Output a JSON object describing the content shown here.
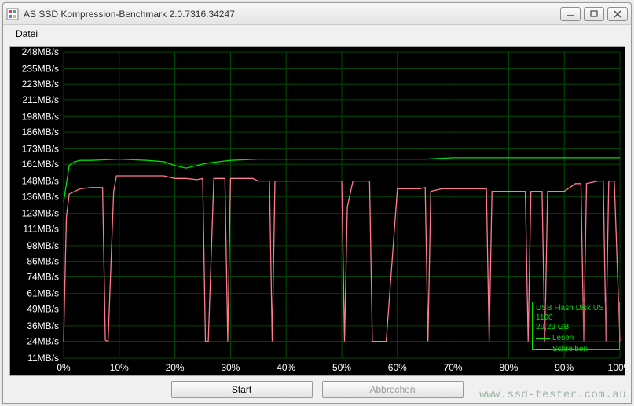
{
  "window": {
    "title": "AS SSD Kompression-Benchmark 2.0.7316.34247"
  },
  "menu": {
    "datei": "Datei"
  },
  "buttons": {
    "start": "Start",
    "abort": "Abbrechen"
  },
  "legend": {
    "device": "USB Flash Disk US",
    "device_line2": "1100",
    "size": "29,29 GB",
    "read": "Lesen",
    "write": "Schreiben",
    "read_color": "#00e000",
    "write_color": "#ff7a90"
  },
  "watermark": "www.ssd-tester.com.au",
  "chart_data": {
    "type": "line",
    "title": "",
    "xlabel": "",
    "ylabel": "",
    "y_ticks": [
      "248MB/s",
      "235MB/s",
      "223MB/s",
      "211MB/s",
      "198MB/s",
      "186MB/s",
      "173MB/s",
      "161MB/s",
      "148MB/s",
      "136MB/s",
      "123MB/s",
      "111MB/s",
      "98MB/s",
      "86MB/s",
      "74MB/s",
      "61MB/s",
      "49MB/s",
      "36MB/s",
      "24MB/s",
      "11MB/s"
    ],
    "y_range": [
      11,
      248
    ],
    "x_ticks": [
      "0%",
      "10%",
      "20%",
      "30%",
      "40%",
      "50%",
      "60%",
      "70%",
      "80%",
      "90%",
      "100%"
    ],
    "x_range": [
      0,
      100
    ],
    "series": [
      {
        "name": "Lesen",
        "color": "#00e000",
        "x": [
          0,
          1,
          2,
          3,
          4,
          5,
          10,
          15,
          18,
          20,
          22,
          24,
          26,
          28,
          30,
          35,
          40,
          45,
          50,
          55,
          60,
          65,
          70,
          75,
          80,
          85,
          90,
          95,
          100
        ],
        "y": [
          132,
          160,
          163,
          164,
          164,
          164,
          165,
          164,
          163,
          160,
          158,
          160,
          162,
          163,
          164,
          165,
          165,
          165,
          165,
          165,
          165,
          165,
          166,
          166,
          166,
          166,
          166,
          166,
          166
        ]
      },
      {
        "name": "Schreiben",
        "color": "#ff7a90",
        "x": [
          0,
          0.5,
          1,
          2,
          3,
          5,
          7,
          7.5,
          8,
          9,
          9.5,
          10,
          12,
          15,
          18,
          20,
          22,
          24,
          25,
          25.5,
          26,
          27,
          29,
          29.5,
          30,
          32,
          34,
          35,
          36,
          37,
          37.5,
          38,
          40,
          43,
          46,
          49,
          50,
          50.5,
          51,
          52,
          53,
          55,
          55.5,
          56,
          57,
          57.5,
          58,
          60,
          62,
          64,
          65,
          65.5,
          66,
          68,
          70,
          73,
          75,
          76,
          76.5,
          77,
          79,
          81,
          83,
          83.5,
          84,
          86,
          86.5,
          87,
          88,
          90,
          92,
          93,
          93.5,
          94,
          96,
          97,
          97.5,
          98,
          99,
          100
        ],
        "y": [
          24,
          120,
          138,
          140,
          142,
          143,
          143,
          25,
          24,
          140,
          152,
          152,
          152,
          152,
          152,
          150,
          150,
          149,
          150,
          24,
          24,
          150,
          150,
          24,
          150,
          150,
          150,
          148,
          148,
          148,
          24,
          148,
          148,
          148,
          148,
          148,
          148,
          24,
          128,
          148,
          148,
          148,
          24,
          24,
          24,
          24,
          24,
          142,
          142,
          142,
          143,
          24,
          140,
          142,
          142,
          142,
          142,
          142,
          24,
          140,
          140,
          140,
          140,
          24,
          140,
          140,
          24,
          140,
          140,
          140,
          146,
          146,
          24,
          146,
          148,
          148,
          24,
          148,
          148,
          24
        ]
      }
    ]
  }
}
